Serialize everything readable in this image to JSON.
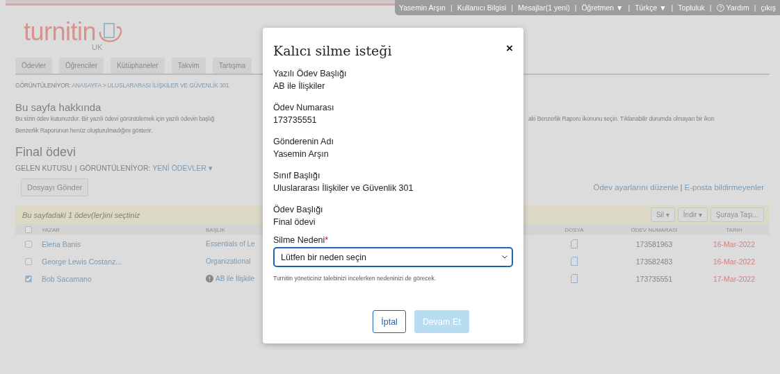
{
  "top_bar": {
    "separator": "|",
    "links": [
      {
        "label": "Yasemin Arşın",
        "kind": "text"
      },
      {
        "label": "Kullanıcı Bilgisi",
        "kind": "text"
      },
      {
        "label": "Mesajlar(1 yeni)",
        "kind": "text"
      },
      {
        "label": "Öğretmen ▼",
        "kind": "text"
      },
      {
        "label": "Türkçe ▼",
        "kind": "text"
      },
      {
        "label": "Topluluk",
        "kind": "text"
      },
      {
        "label": "Yardım",
        "kind": "help"
      },
      {
        "label": "çıkış",
        "kind": "text"
      }
    ]
  },
  "logo": {
    "name": "turnitin",
    "region": "UK"
  },
  "tabs": [
    {
      "label": "Ödevler",
      "selected": false
    },
    {
      "label": "Öğrenciler",
      "selected": false
    },
    {
      "label": "Kütüphaneler",
      "selected": false
    },
    {
      "label": "Takvim",
      "selected": false
    },
    {
      "label": "Tartışma",
      "selected": false
    }
  ],
  "breadcrumb": {
    "prefix": "GÖRÜNTÜLENİYOR:",
    "path": "ANASAYFA > ULUSLARARASI İLİŞKİLER VE GÜVENLİK 301"
  },
  "about": {
    "title": "Bu sayfa hakkında",
    "line_1_left": "Bu sizin ödev kutunuzdur. Bir yazılı ödevi görüntülemek için yazılı ödevin başlığ",
    "line_1_right": "aki Benzerlik Raporu ikonunu seçin. Tıklanabilir durumda olmayan bir ikon",
    "line_2": "Benzerlik Raporunun henüz oluşturulmadığını gösterir."
  },
  "assignment": {
    "title": "Final ödevi",
    "inbox": "GELEN KUTUSU",
    "separator": "|",
    "viewing": "GÖRÜNTÜLENİYOR:",
    "filter": "YENİ ÖDEVLER ▾"
  },
  "submit_button": "Dosyayı Gönder",
  "right_links": {
    "separator": "|",
    "items": [
      "Ödev ayarlarını düzenle",
      "E-posta bildirmeyenler"
    ]
  },
  "selection_bar": {
    "text": "Bu sayfadaki 1 ödev(ler)ini seçtiniz",
    "buttons": [
      "Sil ▾",
      "İndir ▾",
      "Şuraya Taşı..."
    ]
  },
  "table": {
    "columns": [
      "YAZAR",
      "BAŞLIK",
      "DOSYA",
      "ÖDEV NUMARASI",
      "TARİH"
    ],
    "header_checked": false,
    "rows": [
      {
        "checked": false,
        "author": "Elena Banis",
        "title": "Essentials of Le",
        "warning": false,
        "paper_id": "173581963",
        "date": "16-Mar-2022"
      },
      {
        "checked": false,
        "author": "George Lewis Costanz...",
        "title": "Organizational",
        "warning": false,
        "paper_id": "173582483",
        "date": "16-Mar-2022"
      },
      {
        "checked": true,
        "author": "Bob Sacamano",
        "title": "AB ile İlişkile",
        "warning": true,
        "paper_id": "173735551",
        "date": "17-Mar-2022"
      }
    ]
  },
  "modal": {
    "title": "Kalıcı silme isteği",
    "close": "×",
    "fields": [
      {
        "label": "Yazılı Ödev Başlığı",
        "value": "AB ile İlişkiler"
      },
      {
        "label": "Ödev Numarası",
        "value": "173735551"
      },
      {
        "label": "Gönderenin Adı",
        "value": "Yasemin Arşın"
      },
      {
        "label": "Sınıf Başlığı",
        "value": "Uluslararası İlişkiler ve Güvenlik 301"
      },
      {
        "label": "Ödev Başlığı",
        "value": "Final ödevi"
      }
    ],
    "reason_label": "Silme Nedeni",
    "required_mark": "*",
    "reason_value": "Lütfen bir neden seçin",
    "hint": "Turnitin yöneticiniz talebinizi incelerken nedeninizi de görecek.",
    "buttons": [
      {
        "label": "İptal",
        "kind": "secondary",
        "disabled": false
      },
      {
        "label": "Devam Et",
        "kind": "primary",
        "disabled": true
      }
    ]
  }
}
